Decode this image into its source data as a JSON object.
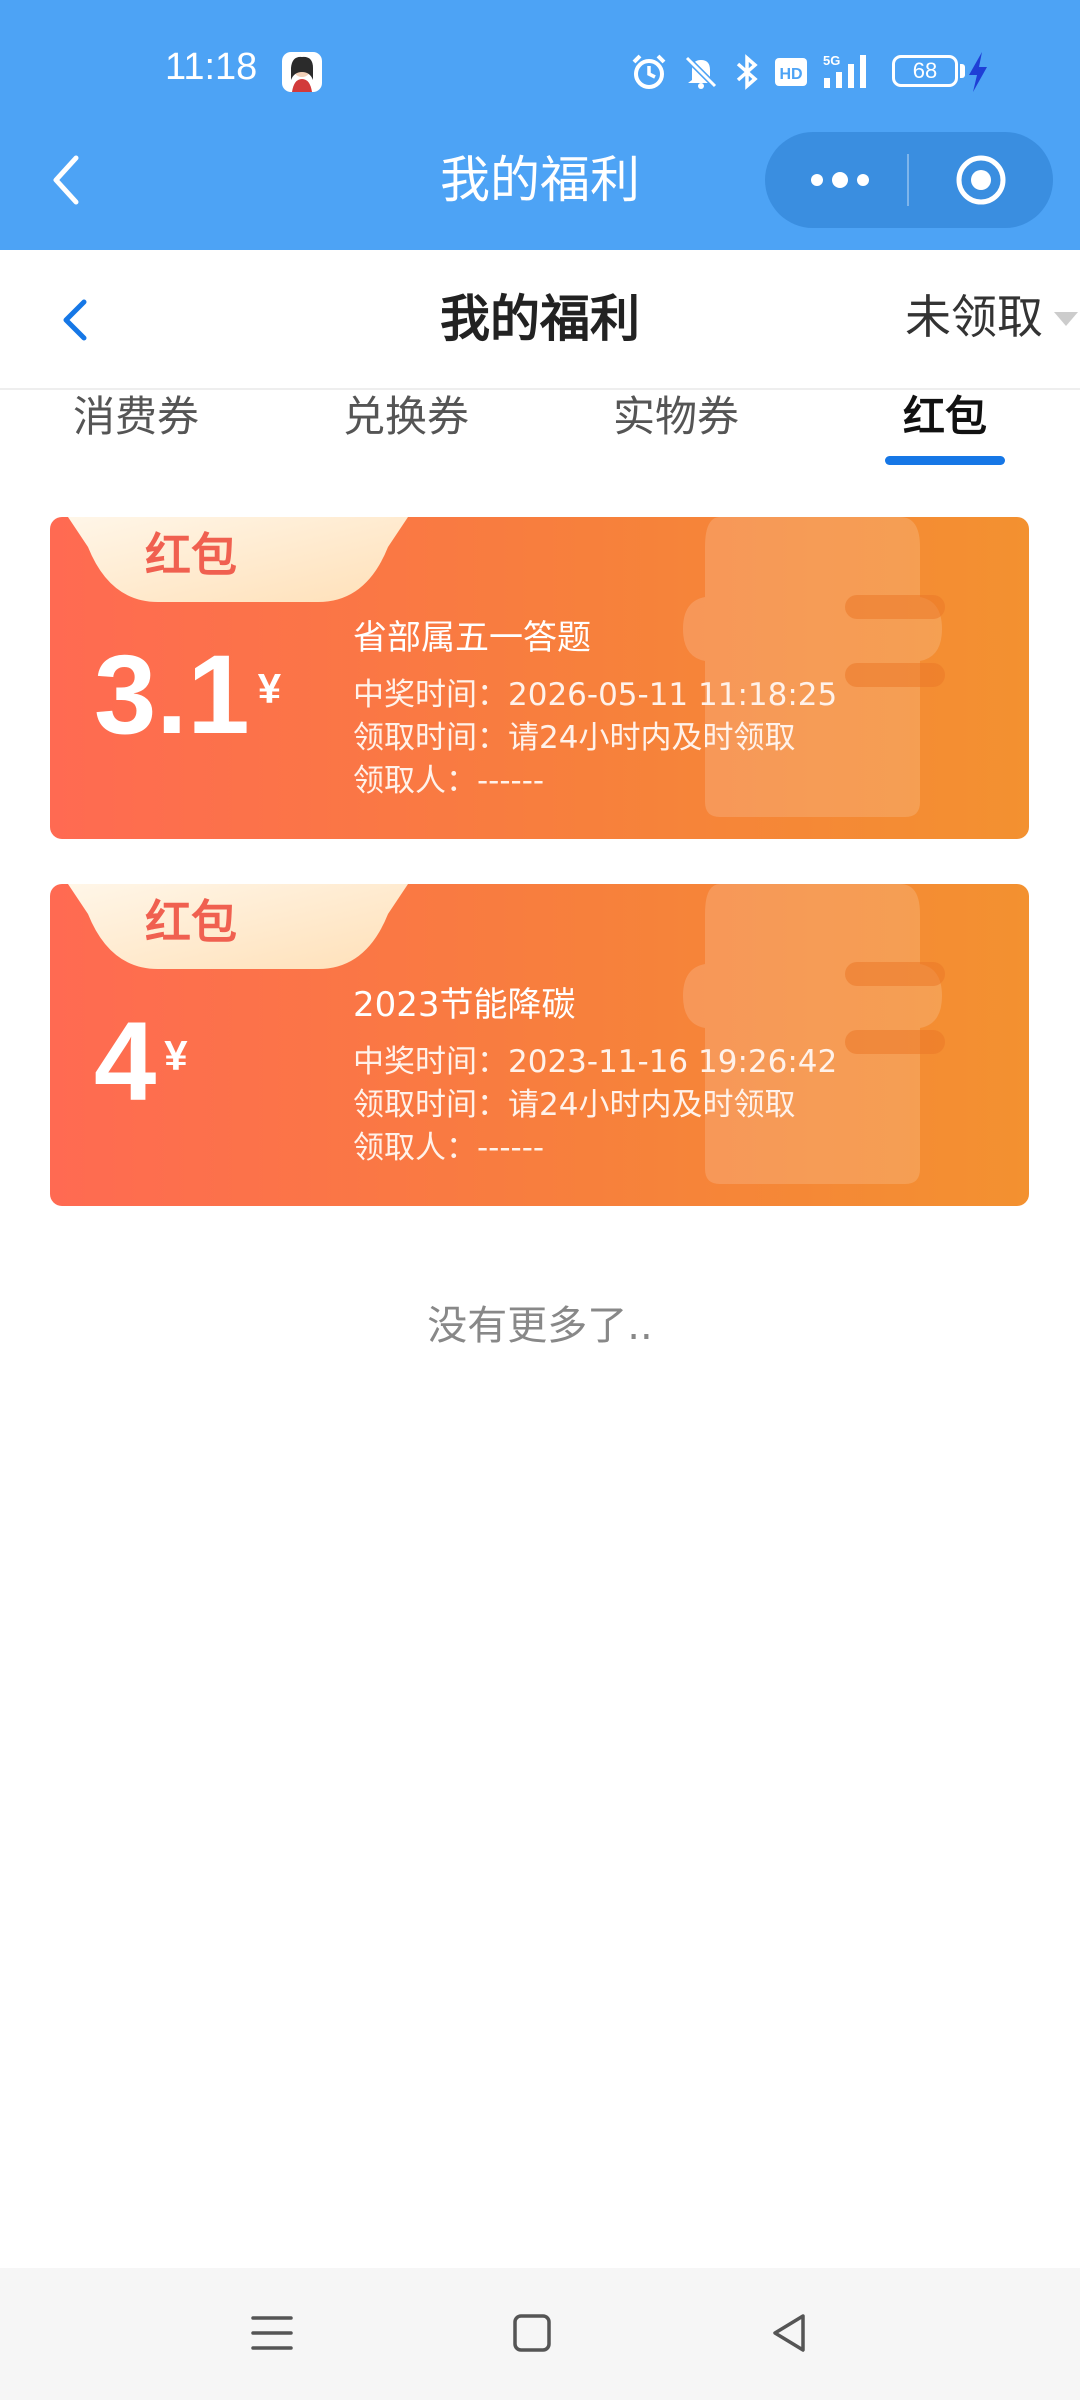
{
  "status_bar": {
    "time": "11:18",
    "battery": "68",
    "icons": [
      "alarm-icon",
      "mute-icon",
      "bluetooth-icon",
      "hd-icon",
      "5g-signal-icon",
      "battery-icon",
      "charging-icon"
    ]
  },
  "mini_app_header": {
    "title": "我的福利"
  },
  "page_header": {
    "title": "我的福利",
    "filter_label": "未领取"
  },
  "tabs": [
    {
      "label": "消费券",
      "active": false
    },
    {
      "label": "兑换券",
      "active": false
    },
    {
      "label": "实物券",
      "active": false
    },
    {
      "label": "红包",
      "active": true
    }
  ],
  "cards": [
    {
      "tag": "红包",
      "amount": "3.1",
      "currency": "¥",
      "name": "省部属五一答题",
      "win_time": "中奖时间：2026-05-11 11:18:25",
      "claim_time": "领取时间：请24小时内及时领取",
      "claimant": "领取人：------"
    },
    {
      "tag": "红包",
      "amount": "4",
      "currency": "¥",
      "name": "2023节能降碳",
      "win_time": "中奖时间：2023-11-16 19:26:42",
      "claim_time": "领取时间：请24小时内及时领取",
      "claimant": "领取人：------"
    }
  ],
  "footer_text": "没有更多了..",
  "colors": {
    "header_blue": "#4da3f5",
    "tab_accent": "#1677e6",
    "card_start": "#ff6a52",
    "card_end": "#f39130"
  }
}
